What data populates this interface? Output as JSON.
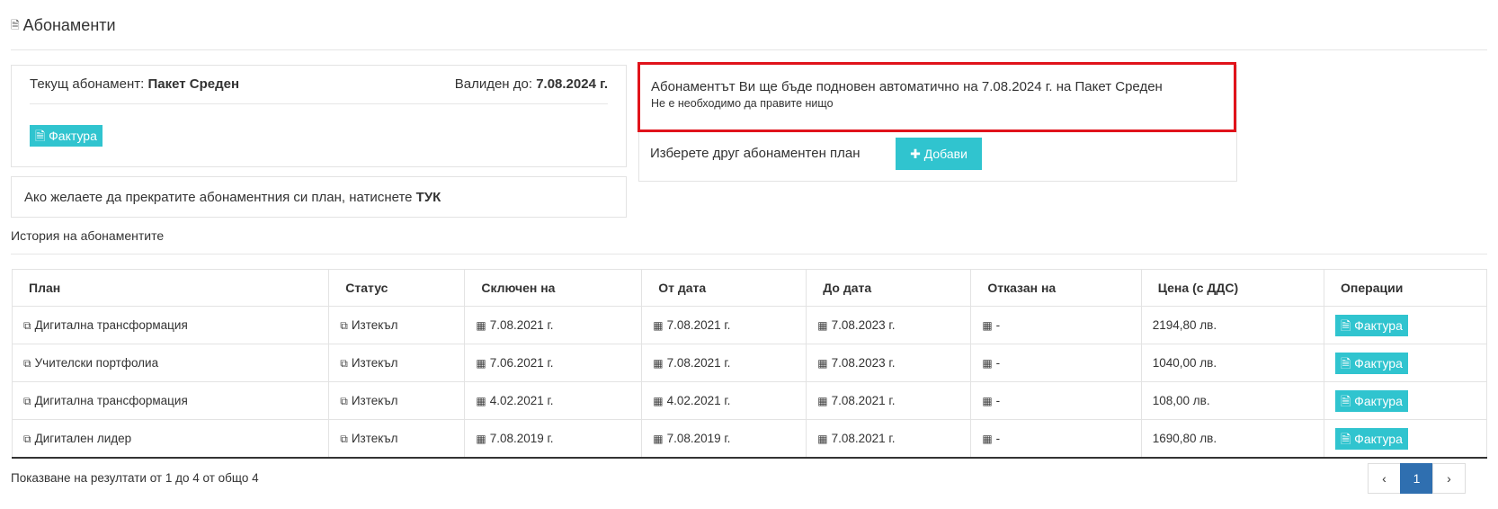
{
  "header": {
    "title": "Абонаменти",
    "icon": "document-icon"
  },
  "current": {
    "label": "Текущ абонамент:",
    "plan": "Пакет Среден",
    "valid_label": "Валиден до:",
    "valid_date": "7.08.2024 г.",
    "invoice_label": "Фактура"
  },
  "cancel": {
    "text": "Ако желаете да прекратите абонаментния си план, натиснете",
    "link": "ТУК"
  },
  "renew": {
    "line1": "Абонаментът Ви ще бъде подновен автоматично на 7.08.2024 г. на Пакет Среден",
    "line2": "Не е необходимо да правите нищо",
    "other_plan": "Изберете друг абонаментен план",
    "add_label": "Добави"
  },
  "history": {
    "title": "История на абонаментите",
    "columns": [
      "План",
      "Статус",
      "Сключен на",
      "От дата",
      "До дата",
      "Отказан на",
      "Цена (с ДДС)",
      "Операции"
    ],
    "rows": [
      {
        "plan": "Дигитална трансформация",
        "status": "Изтекъл",
        "signed": "7.08.2021 г.",
        "from": "7.08.2021 г.",
        "to": "7.08.2023 г.",
        "cancelled": "-",
        "price": "2194,80 лв.",
        "op": "Фактура"
      },
      {
        "plan": "Учителски портфолиа",
        "status": "Изтекъл",
        "signed": "7.06.2021 г.",
        "from": "7.08.2021 г.",
        "to": "7.08.2023 г.",
        "cancelled": "-",
        "price": "1040,00 лв.",
        "op": "Фактура"
      },
      {
        "plan": "Дигитална трансформация",
        "status": "Изтекъл",
        "signed": "4.02.2021 г.",
        "from": "4.02.2021 г.",
        "to": "7.08.2021 г.",
        "cancelled": "-",
        "price": "108,00 лв.",
        "op": "Фактура"
      },
      {
        "plan": "Дигитален лидер",
        "status": "Изтекъл",
        "signed": "7.08.2019 г.",
        "from": "7.08.2019 г.",
        "to": "7.08.2021 г.",
        "cancelled": "-",
        "price": "1690,80 лв.",
        "op": "Фактура"
      }
    ]
  },
  "footer": {
    "results_text": "Показване на резултати от 1 до 4 от общо 4",
    "pager": {
      "prev": "‹",
      "current_page": "1",
      "next": "›"
    }
  },
  "colors": {
    "accent": "#30c4cf",
    "highlight_border": "#e0131b",
    "pager_active": "#2f6fb0"
  }
}
